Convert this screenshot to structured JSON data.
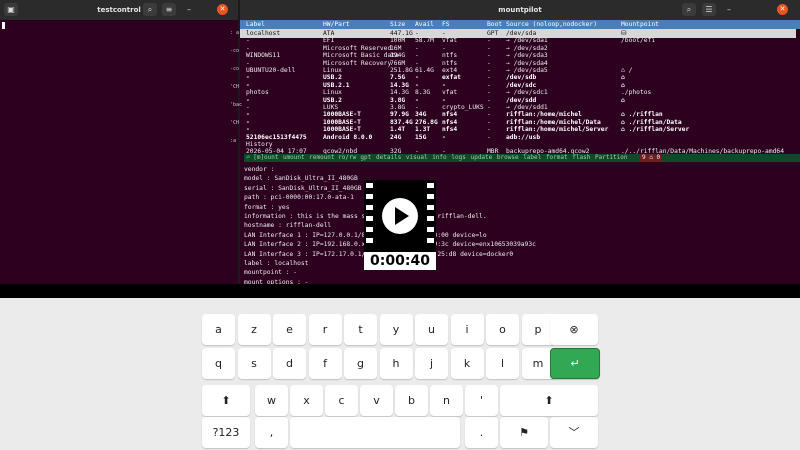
{
  "left_window": {
    "title": "testcontrol",
    "buttons": {
      "menu": "▣",
      "search": "⌕",
      "minimize": "–",
      "close": "✕"
    },
    "side_chars": [
      ": a",
      "-co",
      "-co",
      "'CH",
      "'bac",
      "'CH",
      ":a"
    ]
  },
  "right_window": {
    "title": "mountpilot",
    "buttons": {
      "search": "⌕",
      "menu": "☰",
      "minimize": "–",
      "close": "✕"
    },
    "table": {
      "headers": [
        "Label",
        "HW/Part",
        "Size",
        "Avail",
        "FS",
        "Boot",
        "Source (noloop,nodocker)",
        "Mountpoint"
      ],
      "rows": [
        {
          "label": "localhost",
          "hw": "ATA",
          "size": "447.1G",
          "avail": "-",
          "fs": "-",
          "boot": "GPT",
          "source": "/dev/sda",
          "mount": "⛁",
          "selected": true
        },
        {
          "label": "-",
          "hw": "EFI",
          "size": "100M",
          "avail": "58.7M",
          "fs": "vfat",
          "boot": "-",
          "source": "→ /dev/sda1",
          "mount": "/boot/efi"
        },
        {
          "label": "-",
          "hw": "Microsoft Reserved",
          "size": "16M",
          "avail": "-",
          "fs": "-",
          "boot": "-",
          "source": "→ /dev/sda2",
          "mount": ""
        },
        {
          "label": "WINDOWS11",
          "hw": "Microsoft Basic data",
          "size": "194G",
          "avail": "-",
          "fs": "ntfs",
          "boot": "-",
          "source": "→ /dev/sda3",
          "mount": ""
        },
        {
          "label": "-",
          "hw": "Microsoft Recovery",
          "size": "766M",
          "avail": "-",
          "fs": "ntfs",
          "boot": "-",
          "source": "→ /dev/sda4",
          "mount": ""
        },
        {
          "label": "UBUNTU20-dell",
          "hw": "Linux",
          "size": "251.8G",
          "avail": "61.4G",
          "fs": "ext4",
          "boot": "-",
          "source": "→ /dev/sda5",
          "mount": "⌂ /"
        },
        {
          "label": "-",
          "hw": "USB.2",
          "size": "7.5G",
          "avail": "-",
          "fs": "exfat",
          "boot": "-",
          "source": "/dev/sdb",
          "mount": "⌂",
          "bold": true
        },
        {
          "label": "-",
          "hw": "USB.2.1",
          "size": "14.3G",
          "avail": "-",
          "fs": "-",
          "boot": "-",
          "source": "/dev/sdc",
          "mount": "⌂",
          "bold": true
        },
        {
          "label": "photos",
          "hw": "Linux",
          "size": "14.3G",
          "avail": "8.3G",
          "fs": "vfat",
          "boot": "-",
          "source": "→ /dev/sdc1",
          "mount": "./photos"
        },
        {
          "label": "-",
          "hw": "USB.2",
          "size": "3.8G",
          "avail": "-",
          "fs": "-",
          "boot": "-",
          "source": "/dev/sdd",
          "mount": "⌂",
          "bold": true
        },
        {
          "label": "-",
          "hw": "LUKS",
          "size": "3.8G",
          "avail": "-",
          "fs": "crypto_LUKS",
          "boot": "-",
          "source": "→ /dev/sdd1",
          "mount": ""
        },
        {
          "label": "-",
          "hw": "1000BASE-T",
          "size": "97.9G",
          "avail": "34G",
          "fs": "nfs4",
          "boot": "-",
          "source": "rifflan:/home/michel",
          "mount": "⌂ ./rifflan",
          "bold": true
        },
        {
          "label": "-",
          "hw": "1000BASE-T",
          "size": "837.4G",
          "avail": "276.8G",
          "fs": "nfs4",
          "boot": "-",
          "source": "rifflan:/home/michel/Data",
          "mount": "⌂ ./rifflan/Data",
          "bold": true
        },
        {
          "label": "-",
          "hw": "1000BASE-T",
          "size": "1.4T",
          "avail": "1.3T",
          "fs": "nfs4",
          "boot": "-",
          "source": "rifflan:/home/michel/Server",
          "mount": "⌂ ./rifflan/Server",
          "bold": true
        },
        {
          "label": "52106ec1513f4475",
          "hw": "Android 8.0.0",
          "size": "24G",
          "avail": "15G",
          "fs": "-",
          "boot": "-",
          "source": "adb://usb",
          "mount": "",
          "bold": true
        },
        {
          "label": "History",
          "hw": "",
          "size": "",
          "avail": "",
          "fs": "",
          "boot": "",
          "source": "",
          "mount": ""
        },
        {
          "label": "2026-05-04 17:07",
          "hw": "qcow2/nbd",
          "size": "32G",
          "avail": "-",
          "fs": "-",
          "boot": "MBR",
          "source": "backuprepo-amd64.qcow2",
          "mount": "./../rifflan/Data/Machines/backuprepo-amd64"
        }
      ]
    },
    "menubar": {
      "items": [
        "⏎ [m]ount",
        "umount",
        "remount ro/rw",
        "gpt",
        "details",
        "visual",
        "info",
        "logs",
        "update",
        "browse",
        "label",
        "format",
        "flash",
        "Partition"
      ],
      "right": "9 ⌂ 0"
    },
    "details": [
      "vendor :",
      "model : SanDisk_Ultra_II_480GB",
      "serial : SanDisk_Ultra_II_480GB",
      "path : pci-0000:00:17.0-ata-1",
      "format : yes",
      "information : this is the mass storage of the host rifflan-dell.",
      "hostname : rifflan-dell",
      "LAN Interface 1 : IP=127.0.0.1/8 mac=00:00:00:00:00:00 device=lo",
      "LAN Interface 2 : IP=192.168.0.x mac=xx:xx:xx:59:a9:3c device=enx10653039a93c",
      "LAN Interface 3 : IP=172.17.0.1/16 mac=02:42:xx:xx:25:d8 device=docker0",
      "label : localhost",
      "mountpoint : -",
      "mount options : -"
    ]
  },
  "video_overlay": {
    "time": "0:00:40",
    "icon": "video-play-icon"
  },
  "keyboard": {
    "rows": [
      [
        {
          "id": "a",
          "label": "a"
        },
        {
          "id": "z",
          "label": "z"
        },
        {
          "id": "e",
          "label": "e"
        },
        {
          "id": "r",
          "label": "r"
        },
        {
          "id": "t",
          "label": "t"
        },
        {
          "id": "y",
          "label": "y"
        },
        {
          "id": "u",
          "label": "u"
        },
        {
          "id": "i",
          "label": "i"
        },
        {
          "id": "o",
          "label": "o"
        },
        {
          "id": "p",
          "label": "p"
        },
        {
          "id": "backspace",
          "label": "⊗"
        }
      ],
      [
        {
          "id": "q",
          "label": "q"
        },
        {
          "id": "s",
          "label": "s"
        },
        {
          "id": "d",
          "label": "d"
        },
        {
          "id": "f",
          "label": "f"
        },
        {
          "id": "g",
          "label": "g"
        },
        {
          "id": "h",
          "label": "h"
        },
        {
          "id": "j",
          "label": "j"
        },
        {
          "id": "k",
          "label": "k"
        },
        {
          "id": "l",
          "label": "l"
        },
        {
          "id": "m",
          "label": "m"
        },
        {
          "id": "enter",
          "label": "↵"
        }
      ],
      [
        {
          "id": "shift",
          "label": "⬆"
        },
        {
          "id": "w",
          "label": "w"
        },
        {
          "id": "x",
          "label": "x"
        },
        {
          "id": "c",
          "label": "c"
        },
        {
          "id": "v",
          "label": "v"
        },
        {
          "id": "b",
          "label": "b"
        },
        {
          "id": "n",
          "label": "n"
        },
        {
          "id": "apostrophe",
          "label": "'"
        },
        {
          "id": "shift-right",
          "label": "⬆"
        }
      ],
      [
        {
          "id": "symbols",
          "label": "?123"
        },
        {
          "id": "comma",
          "label": ","
        },
        {
          "id": "space",
          "label": ""
        },
        {
          "id": "period",
          "label": "."
        },
        {
          "id": "emoji",
          "label": "⚑"
        },
        {
          "id": "hide",
          "label": "﹀"
        }
      ]
    ]
  },
  "colors": {
    "terminal_bg": "#2c001e",
    "titlebar": "#2b2b2b",
    "header": "#4a7fb5",
    "enter_key": "#33a853",
    "close_button": "#e95420"
  }
}
